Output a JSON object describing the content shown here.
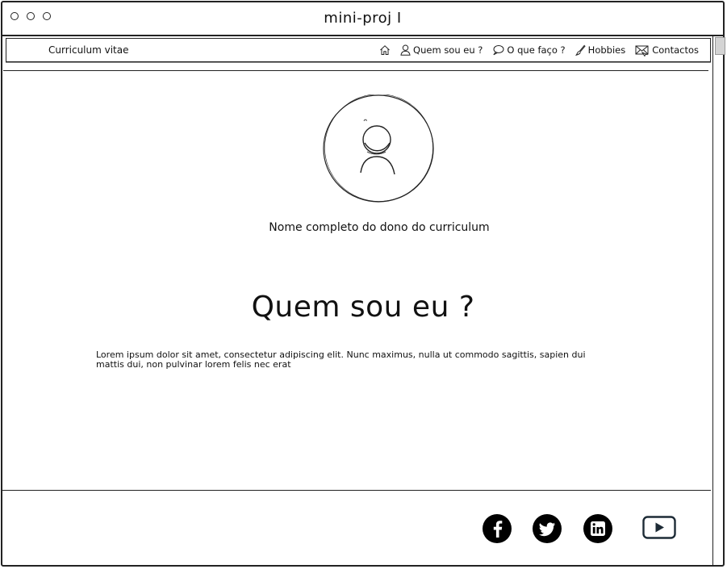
{
  "window": {
    "title": "mini-proj I"
  },
  "navbar": {
    "brand": "Curriculum vitae",
    "items": [
      {
        "label": "",
        "icon": "home-icon"
      },
      {
        "label": "Quem sou eu ?",
        "icon": "user-icon"
      },
      {
        "label": "O que faço ?",
        "icon": "speech-bubble-icon"
      },
      {
        "label": "Hobbies",
        "icon": "brush-icon"
      },
      {
        "label": "Contactos",
        "icon": "envelope-icon"
      }
    ]
  },
  "profile": {
    "name": "Nome completo do dono do curriculum",
    "avatar_icon": "user-avatar-icon"
  },
  "section": {
    "heading": "Quem sou eu ?",
    "body": "Lorem ipsum dolor sit amet, consectetur adipiscing elit. Nunc maximus, nulla ut commodo sagittis, sapien dui mattis dui, non pulvinar lorem felis nec erat"
  },
  "footer": {
    "social": [
      {
        "name": "facebook",
        "icon": "facebook-icon"
      },
      {
        "name": "twitter",
        "icon": "twitter-icon"
      },
      {
        "name": "linkedin",
        "icon": "linkedin-icon"
      },
      {
        "name": "youtube",
        "icon": "youtube-icon"
      }
    ]
  }
}
